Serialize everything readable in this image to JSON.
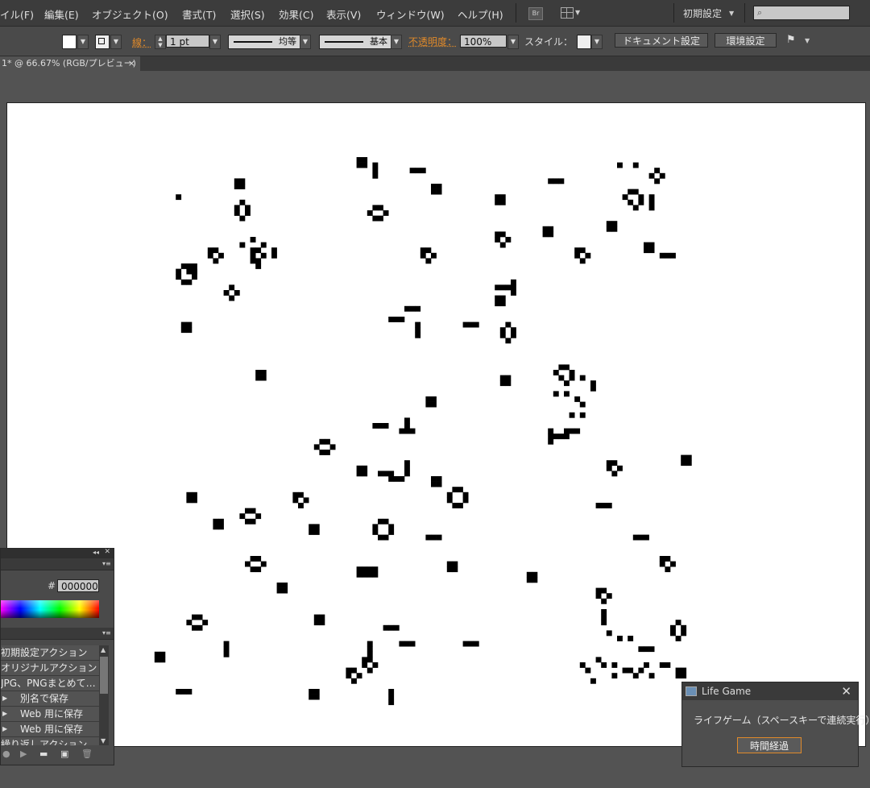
{
  "menubar": {
    "items": [
      "イル(F)",
      "編集(E)",
      "オブジェクト(O)",
      "書式(T)",
      "選択(S)",
      "効果(C)",
      "表示(V)",
      "ウィンドウ(W)",
      "ヘルプ(H)"
    ],
    "bridge_badge": "Br",
    "workspace": "初期設定",
    "search_placeholder": ""
  },
  "control_bar": {
    "stroke_label": "線：",
    "stroke_weight": "1 pt",
    "profile_label": "均等",
    "brush_label": "基本",
    "opacity_label": "不透明度：",
    "opacity_value": "100%",
    "style_label": "スタイル：",
    "doc_settings_button": "ドキュメント設定",
    "preferences_button": "環境設定"
  },
  "document_tab": {
    "label": "1* @ 66.67% (RGB/プレビュー)",
    "close": "×"
  },
  "color_panel": {
    "hex_label": "#",
    "hex_value": "000000"
  },
  "actions_panel": {
    "items": [
      {
        "label": "初期設定アクション",
        "expandable": false
      },
      {
        "label": "オリジナルアクション",
        "expandable": false
      },
      {
        "label": "JPG、PNGまとめて…",
        "expandable": false
      },
      {
        "label": "別名で保存",
        "expandable": true
      },
      {
        "label": "Web 用に保存",
        "expandable": true
      },
      {
        "label": "Web 用に保存",
        "expandable": true
      },
      {
        "label": "繰り返しアクション",
        "expandable": false
      }
    ]
  },
  "lifegame_dialog": {
    "title": "Life Game",
    "close": "✕",
    "message": "ライフゲーム（スペースキーで連続実行）",
    "step_button": "時間経過"
  },
  "colors": {
    "menubar_bg": "#3c3c3c",
    "canvas_bg": "#535353",
    "artboard": "#ffffff",
    "cell": "#000000",
    "accent_orange": "#e08a2a"
  },
  "icons": [
    "search-icon",
    "layout-icon",
    "flag-icon",
    "play-icon",
    "stop-icon",
    "folder-icon",
    "new-action-icon",
    "trash-icon"
  ]
}
